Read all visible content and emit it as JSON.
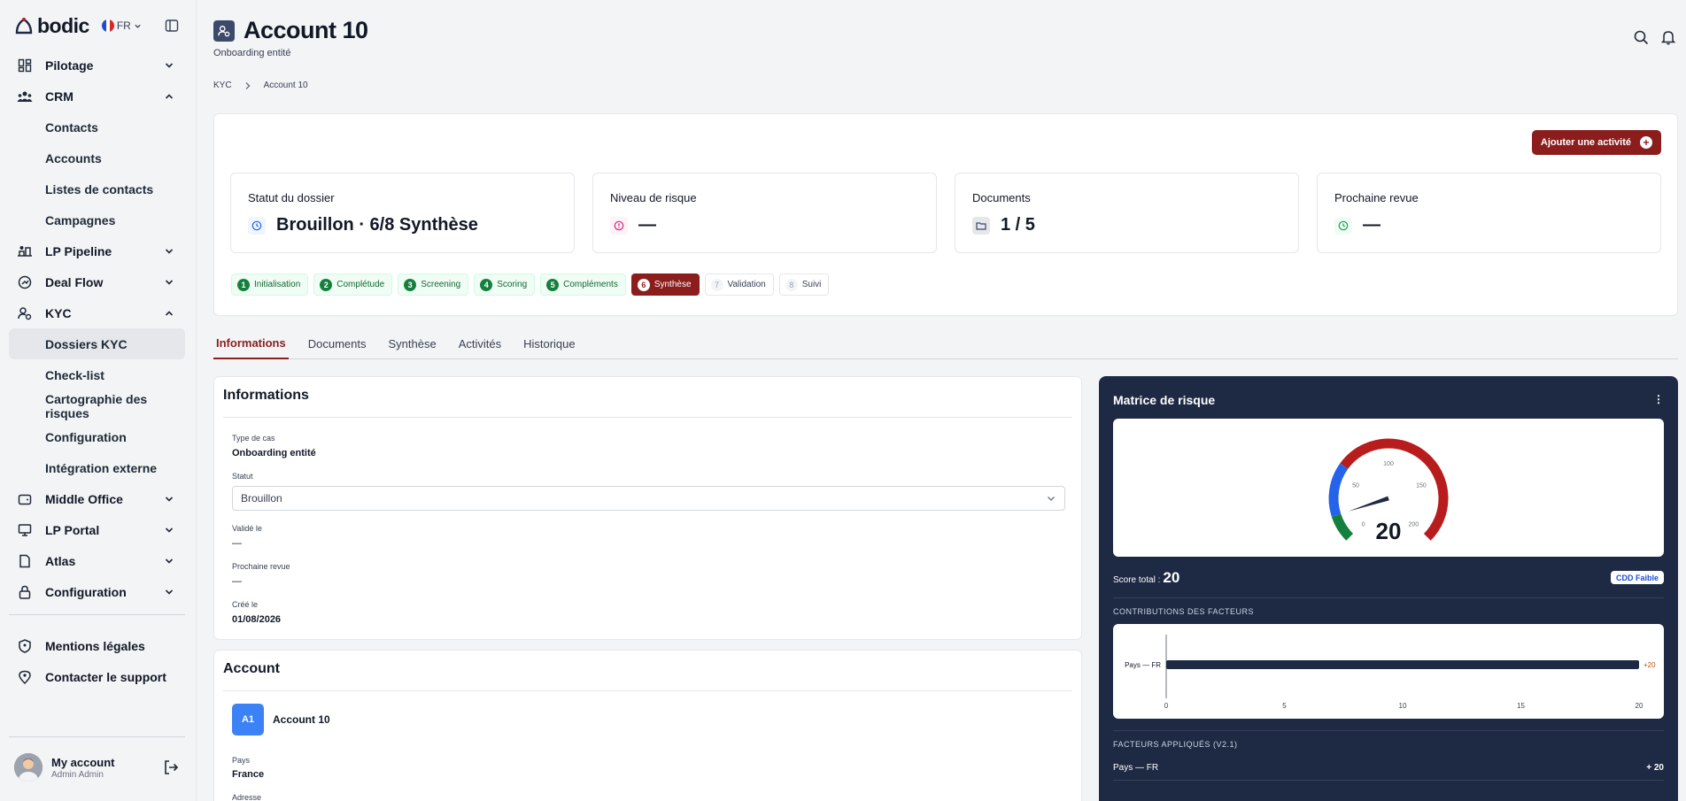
{
  "app": {
    "brand": "bodic",
    "language": "FR"
  },
  "sidebar": {
    "groups": [
      {
        "label": "Pilotage",
        "icon": "dashboard-icon",
        "expanded": false
      },
      {
        "label": "CRM",
        "icon": "users-icon",
        "expanded": true,
        "items": [
          "Contacts",
          "Accounts",
          "Listes de contacts",
          "Campagnes"
        ]
      },
      {
        "label": "LP Pipeline",
        "icon": "pipeline-icon",
        "expanded": false
      },
      {
        "label": "Deal Flow",
        "icon": "deal-flow-icon",
        "expanded": false
      },
      {
        "label": "KYC",
        "icon": "kyc-icon",
        "expanded": true,
        "items": [
          "Dossiers KYC",
          "Check-list",
          "Cartographie des risques",
          "Configuration",
          "Intégration externe"
        ],
        "active_item": "Dossiers KYC"
      },
      {
        "label": "Middle Office",
        "icon": "wallet-icon",
        "expanded": false
      },
      {
        "label": "LP Portal",
        "icon": "monitor-icon",
        "expanded": false
      },
      {
        "label": "Atlas",
        "icon": "file-icon",
        "expanded": false
      },
      {
        "label": "Configuration",
        "icon": "lock-icon",
        "expanded": false
      }
    ],
    "footer_links": [
      {
        "label": "Mentions légales",
        "icon": "shield-icon"
      },
      {
        "label": "Contacter le support",
        "icon": "support-icon"
      }
    ],
    "account": {
      "name": "My account",
      "role": "Admin Admin"
    }
  },
  "header": {
    "title": "Account 10",
    "subtitle": "Onboarding entité",
    "breadcrumb": [
      "KYC",
      "Account 10"
    ]
  },
  "summary": {
    "add_button": "Ajouter une activité",
    "stats": [
      {
        "label": "Statut du dossier",
        "value": "Brouillon · 6/8 Synthèse",
        "icon": "clock-icon",
        "color": "#2563eb"
      },
      {
        "label": "Niveau de risque",
        "value": "—",
        "icon": "alert-icon",
        "color": "#db2777"
      },
      {
        "label": "Documents",
        "value": "1 / 5",
        "icon": "folder-icon",
        "color": "#3b4a6b"
      },
      {
        "label": "Prochaine revue",
        "value": "—",
        "icon": "clock-icon",
        "color": "#16a34a"
      }
    ],
    "steps": [
      {
        "num": "1",
        "label": "Initialisation",
        "state": "done"
      },
      {
        "num": "2",
        "label": "Complétude",
        "state": "done"
      },
      {
        "num": "3",
        "label": "Screening",
        "state": "done"
      },
      {
        "num": "4",
        "label": "Scoring",
        "state": "done"
      },
      {
        "num": "5",
        "label": "Compléments",
        "state": "done"
      },
      {
        "num": "6",
        "label": "Synthèse",
        "state": "current"
      },
      {
        "num": "7",
        "label": "Validation",
        "state": "todo"
      },
      {
        "num": "8",
        "label": "Suivi",
        "state": "todo"
      }
    ]
  },
  "tabs": [
    "Informations",
    "Documents",
    "Synthèse",
    "Activités",
    "Historique"
  ],
  "active_tab": "Informations",
  "informations": {
    "title": "Informations",
    "type_label": "Type de cas",
    "type_value": "Onboarding entité",
    "status_label": "Statut",
    "status_value": "Brouillon",
    "validated_label": "Validé le",
    "validated_value": "—",
    "review_label": "Prochaine revue",
    "review_value": "—",
    "created_label": "Créé le",
    "created_value": "01/08/2026"
  },
  "account_card": {
    "title": "Account",
    "badge": "A1",
    "name": "Account 10",
    "country_label": "Pays",
    "country_value": "France",
    "address_label": "Adresse"
  },
  "risk": {
    "title": "Matrice de risque",
    "menu": "⋮",
    "gauge": {
      "value": 20,
      "min": 0,
      "max": 200,
      "ticks": [
        "0",
        "50",
        "100",
        "150",
        "200"
      ]
    },
    "score_label": "Score total :",
    "score_value": "20",
    "cdd_badge": "CDD Faible",
    "contrib_caption": "CONTRIBUTIONS DES FACTEURS",
    "applied_caption": "FACTEURS APPLIQUÉS (V2.1)",
    "applied": [
      {
        "label": "Pays — FR",
        "points": "+ 20"
      }
    ],
    "colors": {
      "low": "#15803d",
      "medium": "#2563eb",
      "high": "#b91c1c",
      "panel": "#1e2a44"
    }
  },
  "chart_data": {
    "type": "bar",
    "orientation": "horizontal",
    "categories": [
      "Pays — FR"
    ],
    "values": [
      20
    ],
    "data_labels": [
      "+20"
    ],
    "xlim": [
      0,
      20
    ],
    "xticks": [
      "0",
      "5",
      "10",
      "15",
      "20"
    ],
    "title": "",
    "xlabel": "",
    "ylabel": "",
    "bar_color": "#1e2a44",
    "label_color": "#b45309"
  }
}
